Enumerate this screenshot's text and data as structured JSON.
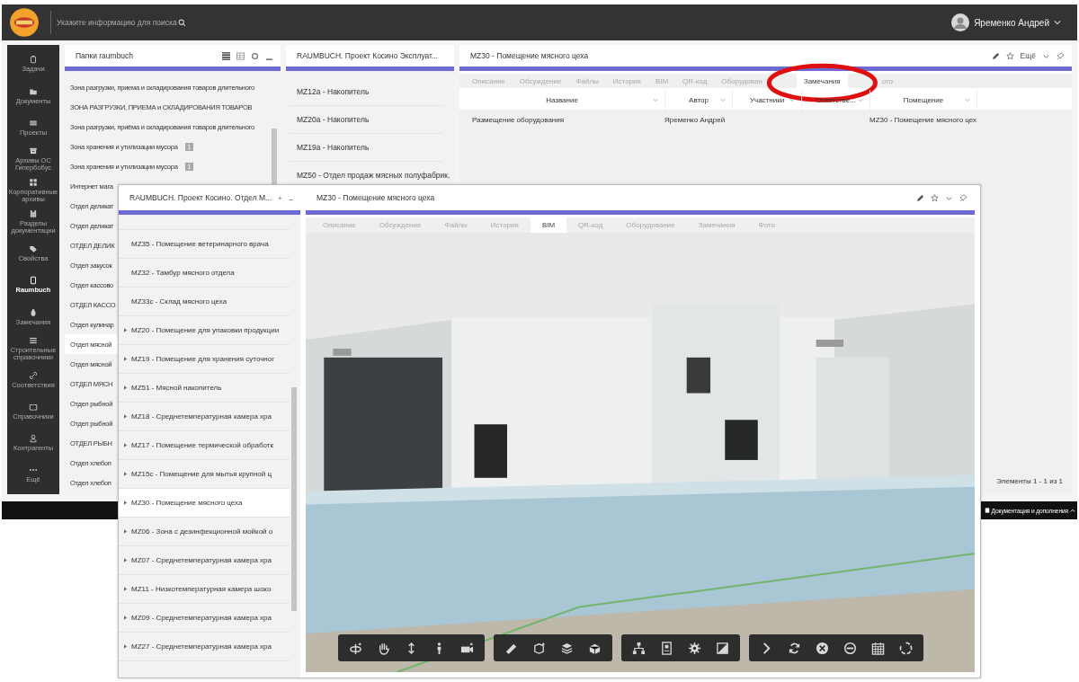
{
  "top_bar": {
    "search": {
      "placeholder": "Укажите информацию для поиска"
    },
    "user": {
      "name": "Яременко Андрей"
    }
  },
  "sidebar": {
    "items": [
      {
        "label": "Задачи",
        "selected": false
      },
      {
        "label": "Документы",
        "selected": false
      },
      {
        "label": "Проекты",
        "selected": false
      },
      {
        "label": "Архивы ОС Гипербобус",
        "selected": false
      },
      {
        "label": "Корпоративные архивы",
        "selected": false
      },
      {
        "label": "Разделы документации",
        "selected": false
      },
      {
        "label": "Свойства",
        "selected": false
      },
      {
        "label": "Raumbuch",
        "selected": true
      },
      {
        "label": "Замечания",
        "selected": false
      },
      {
        "label": "Строительные справочники",
        "selected": false
      },
      {
        "label": "Соответствия",
        "selected": false
      },
      {
        "label": "Справочники",
        "selected": false
      },
      {
        "label": "Контрагенты",
        "selected": false
      },
      {
        "label": "Ещё",
        "selected": false
      }
    ]
  },
  "folders_panel": {
    "title": "Папки raumbuch",
    "items": [
      {
        "label": "Зона разгрузки, приема и складирования товаров длительного",
        "selected": false
      },
      {
        "label": "ЗОНА РАЗГРУЗКИ, ПРИЕМА и СКЛАДИРОВАНИЯ ТОВАРОВ",
        "selected": false
      },
      {
        "label": "Зона разгрузки, приёма и складирования товаров длительного",
        "selected": false
      },
      {
        "label": "Зона хранения и утилизации мусора",
        "badge": "1",
        "selected": false
      },
      {
        "label": "Зона хранения и утилизации мусора",
        "badge": "1",
        "selected": false
      },
      {
        "label": "Интернет мага",
        "selected": false
      },
      {
        "label": "Отдел деликат",
        "selected": false
      },
      {
        "label": "Отдел деликат",
        "selected": false
      },
      {
        "label": "ОТДЕЛ ДЕЛИК",
        "selected": false
      },
      {
        "label": "Отдел закусок",
        "selected": false
      },
      {
        "label": "Отдел кассово",
        "selected": false
      },
      {
        "label": "ОТДЕЛ КАССО",
        "selected": false
      },
      {
        "label": "Отдел кулинар",
        "selected": false
      },
      {
        "label": "Отдел мясной",
        "selected": true
      },
      {
        "label": "Отдел мясной",
        "selected": false
      },
      {
        "label": "ОТДЕЛ МЯСН",
        "selected": false
      },
      {
        "label": "Отдел рыбной",
        "selected": false
      },
      {
        "label": "Отдел рыбной",
        "selected": false
      },
      {
        "label": "ОТДЕЛ РЫБН",
        "selected": false
      },
      {
        "label": "Отдел хлебоп",
        "selected": false
      },
      {
        "label": "Отдел хлебоп",
        "selected": false
      }
    ]
  },
  "rooms_panel": {
    "title": "RAUMBUCH. Проект Косино Эксплуат...",
    "items": [
      {
        "label": "MZ12a - Накопитель",
        "selected": false
      },
      {
        "label": "MZ20a - Накопитель",
        "selected": false
      },
      {
        "label": "MZ19a - Накопитель",
        "selected": false
      },
      {
        "label": "MZ50 - Отдел продаж мясных полуфабрик.",
        "selected": false
      }
    ]
  },
  "room_card": {
    "title": "MZ30 - Помещение мясного цеха",
    "more": "Ещё",
    "tabs": [
      {
        "label": "Описание",
        "selected": false,
        "circled": false
      },
      {
        "label": "Обсуждение",
        "selected": false,
        "circled": false
      },
      {
        "label": "Файлы",
        "selected": false,
        "circled": false
      },
      {
        "label": "История",
        "selected": false,
        "circled": false
      },
      {
        "label": "BIM",
        "selected": false,
        "circled": false
      },
      {
        "label": "QR-код",
        "selected": false,
        "circled": false
      },
      {
        "label": "Оборудован",
        "selected": false,
        "circled": false
      },
      {
        "label": "Замечания",
        "selected": true,
        "circled": true
      },
      {
        "label": "ото",
        "selected": false,
        "circled": false
      }
    ],
    "table": {
      "columns": [
        "Название",
        "Автор",
        "Участники",
        "Ответстве...",
        "Помещение"
      ],
      "rows": [
        {
          "name": "Размещение оборудования",
          "author": "Яременко Андрей",
          "room": "MZ30 - Помещение мясного цех"
        }
      ]
    },
    "footer": "Элементы 1 - 1 из 1"
  },
  "bottom_bar": {
    "link": "Документация и дополнения"
  },
  "overlay_window": {
    "rooms_panel": {
      "title": "RAUMBUCH. Проект Косино. Отдел М...",
      "items": [
        {
          "label": "MZ35 - Помещение ветеринарного врача",
          "expandable": false,
          "selected": false
        },
        {
          "label": "MZ32 - Тамбур мясного отдела",
          "expandable": false,
          "selected": false
        },
        {
          "label": "MZ33c - Склад мясного цеха",
          "expandable": false,
          "selected": false
        },
        {
          "label": "MZ20 - Помещение для упаковки продукции",
          "expandable": true,
          "selected": false
        },
        {
          "label": "MZ19 - Помещение для хранения суточног",
          "expandable": true,
          "selected": false
        },
        {
          "label": "MZ51 - Мясной накопитель",
          "expandable": true,
          "selected": false
        },
        {
          "label": "MZ18 - Среднетемпературная камера хра",
          "expandable": true,
          "selected": false
        },
        {
          "label": "MZ17 - Помещение термической обработк",
          "expandable": true,
          "selected": false
        },
        {
          "label": "MZ15c - Помещение для мытья крупной ц",
          "expandable": true,
          "selected": false
        },
        {
          "label": "MZ30 - Помещение мясного цеха",
          "expandable": true,
          "selected": true
        },
        {
          "label": "MZ06 - Зона с дезинфекционной мойкой о",
          "expandable": true,
          "selected": false
        },
        {
          "label": "MZ07 - Среднетемпературная камера хра",
          "expandable": true,
          "selected": false
        },
        {
          "label": "MZ11 - Низкотемпературная камера шоко",
          "expandable": true,
          "selected": false
        },
        {
          "label": "MZ09 - Среднетемпературная камера хра",
          "expandable": true,
          "selected": false
        },
        {
          "label": "MZ27 - Среднетемпературная камера хра",
          "expandable": true,
          "selected": false
        }
      ]
    },
    "room_card": {
      "title": "MZ30 - Помещение мясного цеха",
      "tabs": [
        {
          "label": "Описание",
          "selected": false
        },
        {
          "label": "Обсуждение",
          "selected": false
        },
        {
          "label": "Файлы",
          "selected": false
        },
        {
          "label": "История",
          "selected": false
        },
        {
          "label": "BIM",
          "selected": true
        },
        {
          "label": "QR-код",
          "selected": false
        },
        {
          "label": "Оборудование",
          "selected": false
        },
        {
          "label": "Замечания",
          "selected": false
        },
        {
          "label": "Фото",
          "selected": false
        }
      ]
    }
  }
}
